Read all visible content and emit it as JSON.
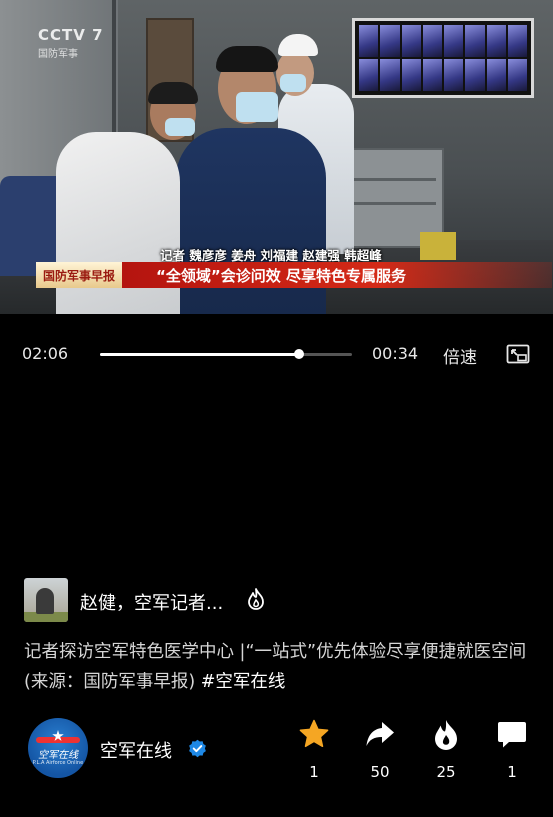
{
  "video": {
    "channel_logo": "CCTV 7",
    "channel_logo_sub": "国防军事",
    "reporters": "记者 魏彦彦 姜舟 刘福建 赵建强 韩超峰",
    "program_tag": "国防军事早报",
    "headline": "“全领域”会诊问效 尽享特色专属服务"
  },
  "player": {
    "current_time": "02:06",
    "remaining_time": "00:34",
    "progress": 0.79,
    "speed_label": "倍速",
    "pip_icon": "picture-in-picture-icon"
  },
  "author": {
    "name": "赵健，空军记者...",
    "badge_icon": "fire-icon"
  },
  "post": {
    "caption": "记者探访空军特色医学中心 |“一站式”优先体验尽享便捷就医空间 (来源：国防军事早报)",
    "hashtag": "#空军在线"
  },
  "channel": {
    "logo_text": "空军在线",
    "logo_subtext": "P.L.A Airforce Online",
    "name": "空军在线",
    "verified_icon": "verified-badge-icon"
  },
  "actions": {
    "favorite_count": "1",
    "share_count": "50",
    "hot_count": "25",
    "comment_count": "1"
  },
  "colors": {
    "accent_star": "#f5a623",
    "verified_blue": "#1e88e5",
    "lower_third_red": "#c81d14"
  }
}
